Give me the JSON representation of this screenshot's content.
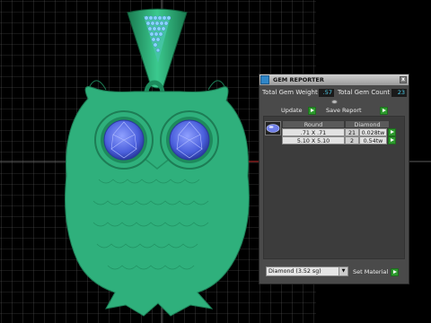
{
  "panel": {
    "title": "GEM REPORTER",
    "close_glyph": "x",
    "total_gem_weight_label": "Total Gem Weight",
    "total_gem_weight_value": ".57",
    "total_gem_count_label": "Total Gem Count",
    "total_gem_count_value": "23",
    "update_label": "Update",
    "save_report_label": "Save Report",
    "table": {
      "headers": [
        "Round",
        "Diamond"
      ],
      "rows": [
        {
          "size": ".71 X .71",
          "count": "21",
          "weight": "0.028tw"
        },
        {
          "size": "5.10 X 5.10",
          "count": "2",
          "weight": "0.54tw"
        }
      ]
    },
    "material_value": "Diamond     (3.52 sg)",
    "set_material_label": "Set Material"
  },
  "colors": {
    "background": "#000000",
    "grid": "#5c5c5c",
    "owl": "#2fb07c",
    "gem": "#5a6fe0",
    "value_text": "#4fd2f0",
    "go_button": "#2e9a2e"
  },
  "icons": [
    "app-icon",
    "close-icon",
    "gem-thumbnail",
    "go-arrow-icon",
    "dropdown-arrow-icon"
  ]
}
